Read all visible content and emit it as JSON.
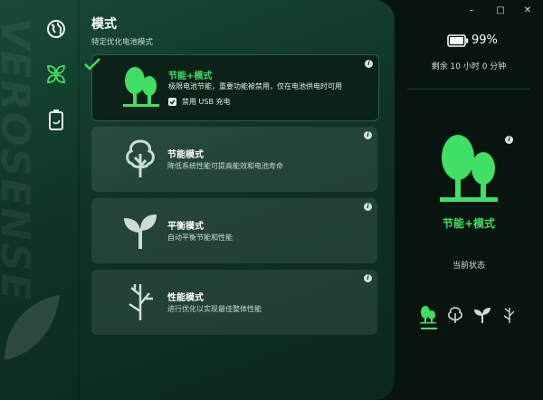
{
  "brand": "VEROSENSE",
  "title": "模式",
  "subtitle": "特定优化电池模式",
  "nav": [
    {
      "name": "globe-icon"
    },
    {
      "name": "leaves-icon"
    },
    {
      "name": "battery-icon"
    }
  ],
  "modes": [
    {
      "name": "节能+模式",
      "desc": "极限电池节能，重要功能被禁用，仅在电池供电时可用",
      "active": true,
      "usb_label": "禁用 USB 充电",
      "usb_checked": true
    },
    {
      "name": "节能模式",
      "desc": "降低系统性能可提高能效和电池寿命"
    },
    {
      "name": "平衡模式",
      "desc": "自动平衡节能和性能"
    },
    {
      "name": "性能模式",
      "desc": "进行优化以实现最佳整体性能"
    }
  ],
  "window": {
    "minimize": "–",
    "maximize": "□",
    "close": "✕"
  },
  "battery": {
    "percent": "99%",
    "level": 0.99,
    "remaining": "剩余 10 小时 0 分钟"
  },
  "current": {
    "name": "节能+模式",
    "label": "当前状态"
  },
  "info_glyph": "i",
  "colors": {
    "accent": "#3fe064",
    "panel": "#0f3324",
    "sidebar": "#08140f"
  }
}
